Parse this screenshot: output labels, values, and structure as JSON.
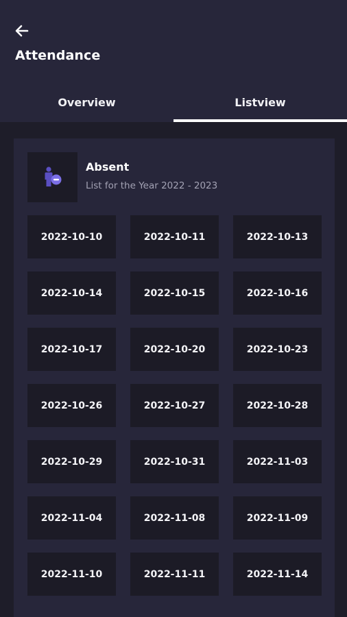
{
  "header": {
    "title": "Attendance"
  },
  "tabs": [
    {
      "label": "Overview",
      "active": false
    },
    {
      "label": "Listview",
      "active": true
    }
  ],
  "summary": {
    "icon": "person-minus-icon",
    "title": "Absent",
    "subtitle": "List for the Year 2022 - 2023"
  },
  "dates": [
    "2022-10-10",
    "2022-10-11",
    "2022-10-13",
    "2022-10-14",
    "2022-10-15",
    "2022-10-16",
    "2022-10-17",
    "2022-10-20",
    "2022-10-23",
    "2022-10-26",
    "2022-10-27",
    "2022-10-28",
    "2022-10-29",
    "2022-10-31",
    "2022-11-03",
    "2022-11-04",
    "2022-11-08",
    "2022-11-09",
    "2022-11-10",
    "2022-11-11",
    "2022-11-14"
  ],
  "colors": {
    "background": "#1e1d29",
    "header": "#27263a",
    "card": "#27263a",
    "cell": "#1c1b26",
    "accent": "#6b5fd3",
    "text": "#ffffff",
    "muted": "#a3a2b4"
  }
}
